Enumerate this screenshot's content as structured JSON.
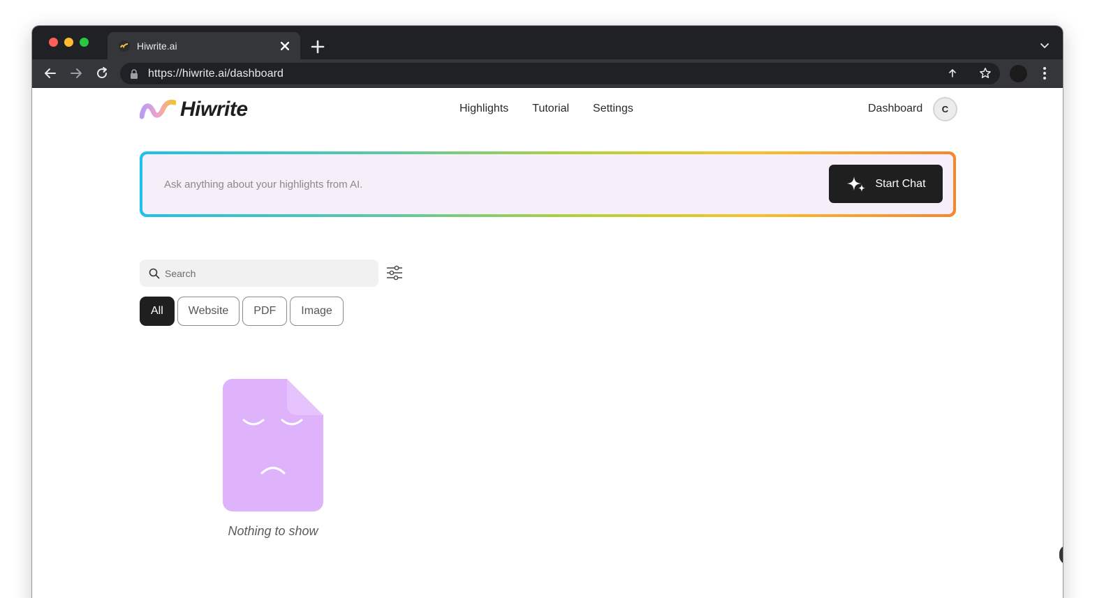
{
  "browser": {
    "tab_title": "Hiwrite.ai",
    "url": "https://hiwrite.ai/dashboard"
  },
  "header": {
    "logo_text": "Hiwrite",
    "nav": [
      "Highlights",
      "Tutorial",
      "Settings"
    ],
    "dashboard_label": "Dashboard",
    "avatar_initial": "C"
  },
  "ai_chat": {
    "placeholder": "Ask anything about your highlights from AI.",
    "button_label": "Start Chat"
  },
  "search": {
    "placeholder": "Search"
  },
  "filters": [
    {
      "label": "All",
      "active": true
    },
    {
      "label": "Website",
      "active": false
    },
    {
      "label": "PDF",
      "active": false
    },
    {
      "label": "Image",
      "active": false
    }
  ],
  "empty_state": {
    "message": "Nothing to show",
    "illustration_color": "#deb3fb"
  },
  "colors": {
    "browser_frame": "#202124",
    "toolbar": "#35363a",
    "primary_button": "#1f1f1f",
    "chat_background": "#f6eef8",
    "gradient": [
      "#1ec1e8",
      "#b5d232",
      "#f7c12a",
      "#f7852f"
    ]
  },
  "icons": [
    "lock-icon",
    "share-icon",
    "star-icon",
    "sparkle-icon",
    "search-icon",
    "filter-sliders-icon",
    "sad-document-icon"
  ]
}
